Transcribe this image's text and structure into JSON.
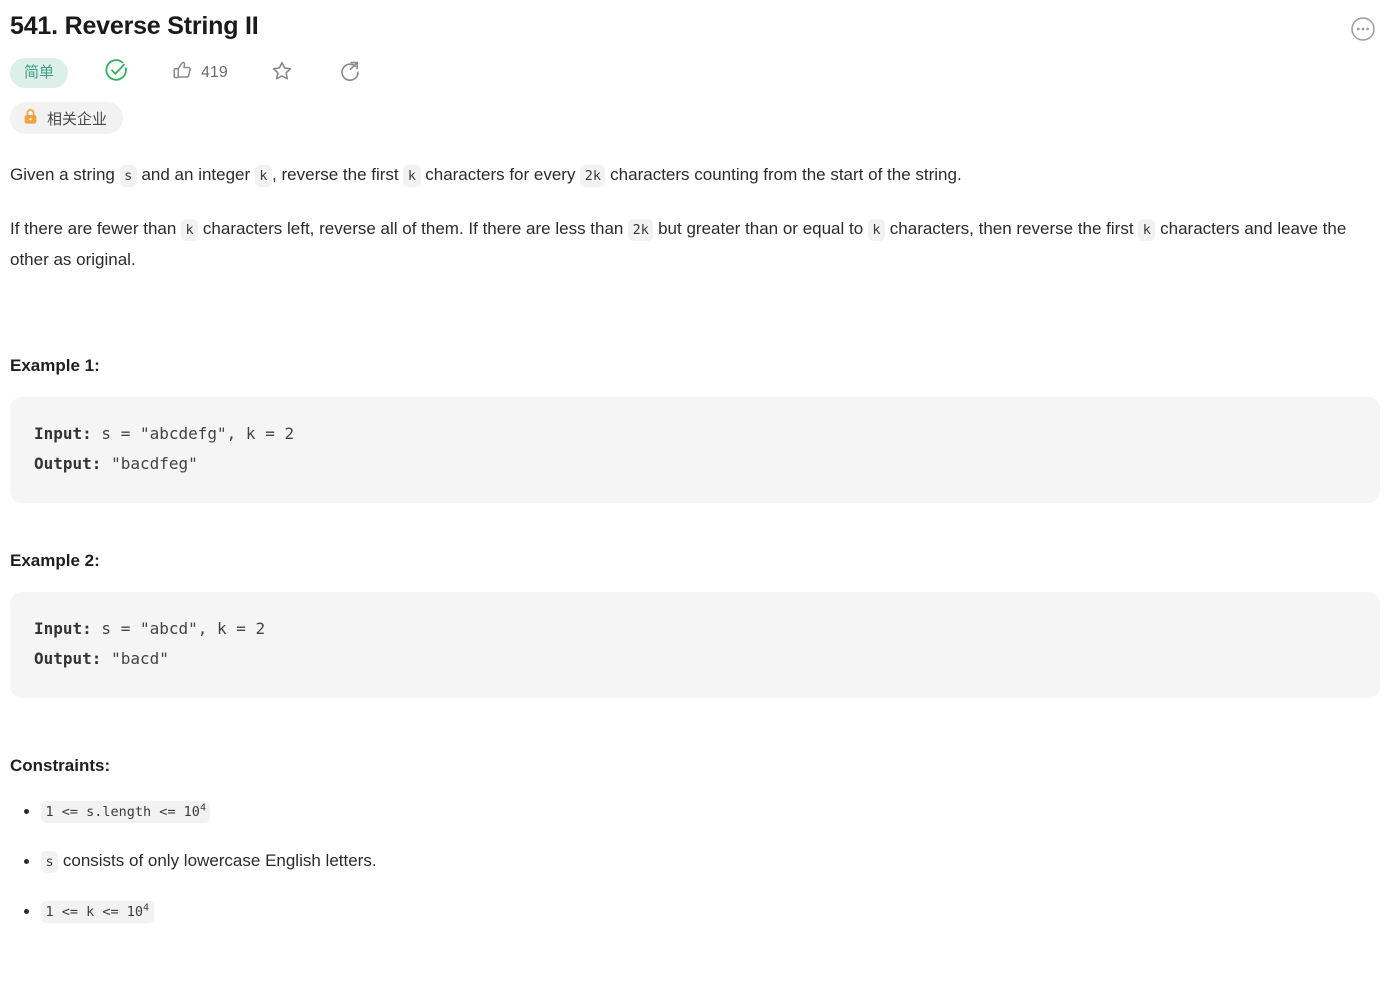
{
  "header": {
    "title": "541. Reverse String II",
    "more_icon": "more-horizontal-circle-icon"
  },
  "meta": {
    "difficulty": "简单",
    "solved_icon": "check-circle-icon",
    "vote_icon": "thumbs-up-icon",
    "vote_count": "419",
    "star_icon": "star-icon",
    "share_icon": "share-circle-icon",
    "company_lock_icon": "lock-icon",
    "company_label": "相关企业"
  },
  "description": {
    "p1": {
      "t1": "Given a string ",
      "c1": "s",
      "t2": " and an integer ",
      "c2": "k",
      "t3": ", reverse the first ",
      "c3": "k",
      "t4": " characters for every ",
      "c4": "2k",
      "t5": " characters counting from the start of the string."
    },
    "p2": {
      "t1": "If there are fewer than ",
      "c1": "k",
      "t2": " characters left, reverse all of them. If there are less than ",
      "c2": "2k",
      "t3": " but greater than or equal to ",
      "c3": "k",
      "t4": " characters, then reverse the first ",
      "c4": "k",
      "t5": " characters and leave the other as original."
    }
  },
  "examples": [
    {
      "heading": "Example 1:",
      "input_label": "Input:",
      "input_value": " s = \"abcdefg\", k = 2",
      "output_label": "Output:",
      "output_value": " \"bacdfeg\""
    },
    {
      "heading": "Example 2:",
      "input_label": "Input:",
      "input_value": " s = \"abcd\", k = 2",
      "output_label": "Output:",
      "output_value": " \"bacd\""
    }
  ],
  "constraints": {
    "heading": "Constraints:",
    "items": [
      {
        "code_prefix": "1 <= s.length <= 10",
        "code_sup": "4",
        "text_after": ""
      },
      {
        "code_prefix": "s",
        "code_sup": "",
        "text_after": " consists of only lowercase English letters."
      },
      {
        "code_prefix": "1 <= k <= 10",
        "code_sup": "4",
        "text_after": ""
      }
    ]
  },
  "colors": {
    "difficulty_bg": "#dcf0e9",
    "difficulty_text": "#3e9e85",
    "solved_green": "#2eb35c",
    "lock_orange": "#f0a33c",
    "code_bg": "#f5f5f5",
    "inline_code_bg": "#f2f2f2"
  }
}
